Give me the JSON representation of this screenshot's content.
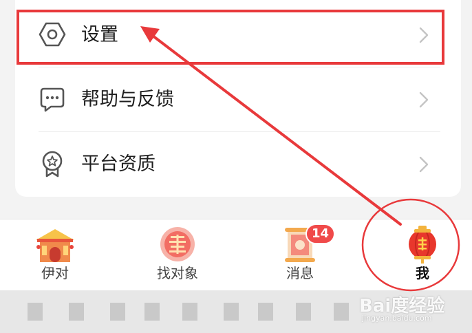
{
  "settings_list": {
    "items": [
      {
        "label": "设置",
        "icon": "hexagon-gear-icon"
      },
      {
        "label": "帮助与反馈",
        "icon": "chat-bubble-icon"
      },
      {
        "label": "平台资质",
        "icon": "award-badge-icon"
      }
    ]
  },
  "tabbar": {
    "tabs": [
      {
        "label": "伊对",
        "icon": "temple-icon",
        "active": false
      },
      {
        "label": "找对象",
        "icon": "double-happiness-icon",
        "active": false
      },
      {
        "label": "消息",
        "icon": "scroll-icon",
        "active": false,
        "badge": "14"
      },
      {
        "label": "我",
        "icon": "lantern-icon",
        "active": true
      }
    ]
  },
  "watermark": {
    "logo": "Bai度经验",
    "url": "jingyan.baidu.com"
  },
  "colors": {
    "annotation_red": "#e8393b",
    "badge_red": "#f04a4a",
    "card_bg": "#ffffff",
    "page_bg": "#f3f3f3"
  }
}
